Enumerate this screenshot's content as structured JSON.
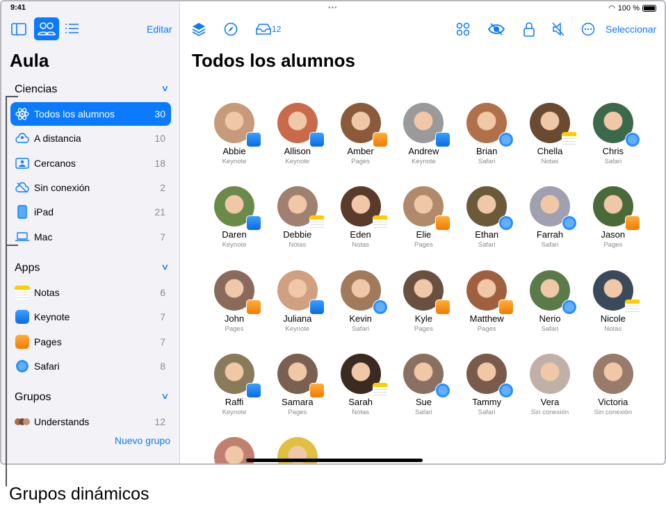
{
  "status": {
    "time": "9:41",
    "battery": "100 %"
  },
  "sidebar": {
    "edit": "Editar",
    "title": "Aula",
    "sections": {
      "ciencias": "Ciencias",
      "apps": "Apps",
      "grupos": "Grupos"
    },
    "ciencias_items": [
      {
        "label": "Todos los alumnos",
        "count": "30",
        "icon": "atom-icon",
        "active": true
      },
      {
        "label": "A distancia",
        "count": "10",
        "icon": "person-cloud-icon"
      },
      {
        "label": "Cercanos",
        "count": "18",
        "icon": "person-rectangle-icon"
      },
      {
        "label": "Sin conexión",
        "count": "2",
        "icon": "cloud-slash-icon"
      },
      {
        "label": "iPad",
        "count": "21",
        "icon": "ipad-icon"
      },
      {
        "label": "Mac",
        "count": "7",
        "icon": "laptop-icon"
      }
    ],
    "app_items": [
      {
        "label": "Notas",
        "count": "6",
        "icon": "notes-app-icon"
      },
      {
        "label": "Keynote",
        "count": "7",
        "icon": "keynote-app-icon"
      },
      {
        "label": "Pages",
        "count": "7",
        "icon": "pages-app-icon"
      },
      {
        "label": "Safari",
        "count": "8",
        "icon": "safari-app-icon"
      }
    ],
    "group_items": [
      {
        "label": "Understands",
        "count": "12",
        "icon": "group-avatars-icon"
      }
    ],
    "new_group": "Nuevo grupo"
  },
  "toolbar": {
    "inbox_count": "12",
    "select": "Seleccionar"
  },
  "main": {
    "title": "Todos los alumnos",
    "students": [
      {
        "name": "Abbie",
        "app": "Keynote",
        "color": "#c79a7a"
      },
      {
        "name": "Allison",
        "app": "Keynote",
        "color": "#c96a4a"
      },
      {
        "name": "Amber",
        "app": "Pages",
        "color": "#8a5a3a"
      },
      {
        "name": "Andrew",
        "app": "Keynote",
        "color": "#9a9a9a"
      },
      {
        "name": "Brian",
        "app": "Safari",
        "color": "#b0704a"
      },
      {
        "name": "Chella",
        "app": "Notas",
        "color": "#6a4a30"
      },
      {
        "name": "Chris",
        "app": "Safari",
        "color": "#3a6a4a"
      },
      {
        "name": "Daren",
        "app": "Keynote",
        "color": "#6a8a4a"
      },
      {
        "name": "Debbie",
        "app": "Notas",
        "color": "#a08070"
      },
      {
        "name": "Eden",
        "app": "Notas",
        "color": "#5a3a2a"
      },
      {
        "name": "Elie",
        "app": "Pages",
        "color": "#b08a6a"
      },
      {
        "name": "Ethan",
        "app": "Safari",
        "color": "#6a5a3a"
      },
      {
        "name": "Farrah",
        "app": "Safari",
        "color": "#a0a0b0"
      },
      {
        "name": "Jason",
        "app": "Pages",
        "color": "#4a6a3a"
      },
      {
        "name": "John",
        "app": "Pages",
        "color": "#8a6a5a"
      },
      {
        "name": "Juliana",
        "app": "Keynote",
        "color": "#d0a080"
      },
      {
        "name": "Kevin",
        "app": "Safari",
        "color": "#a07a5a"
      },
      {
        "name": "Kyle",
        "app": "Pages",
        "color": "#6a5040"
      },
      {
        "name": "Matthew",
        "app": "Pages",
        "color": "#a06040"
      },
      {
        "name": "Nerio",
        "app": "Safari",
        "color": "#5a7a4a"
      },
      {
        "name": "Nicole",
        "app": "Notas",
        "color": "#3a4a5a"
      },
      {
        "name": "Raffi",
        "app": "Keynote",
        "color": "#8a7a5a"
      },
      {
        "name": "Samara",
        "app": "Pages",
        "color": "#7a6050"
      },
      {
        "name": "Sarah",
        "app": "Notas",
        "color": "#3a2a20"
      },
      {
        "name": "Sue",
        "app": "Safari",
        "color": "#8a7060"
      },
      {
        "name": "Tammy",
        "app": "Safari",
        "color": "#7a5a4a"
      },
      {
        "name": "Vera",
        "app": "Sin conexión",
        "color": "#c0b0a8"
      },
      {
        "name": "Victoria",
        "app": "Sin conexión",
        "color": "#9a7a6a"
      },
      {
        "name": "",
        "app": "",
        "color": "#c08070"
      },
      {
        "name": "",
        "app": "",
        "color": "#e0c040"
      }
    ]
  },
  "annotation": "Grupos dinámicos",
  "colors": {
    "accent": "#0a7aff",
    "sidebar": "#f2f2f7"
  }
}
